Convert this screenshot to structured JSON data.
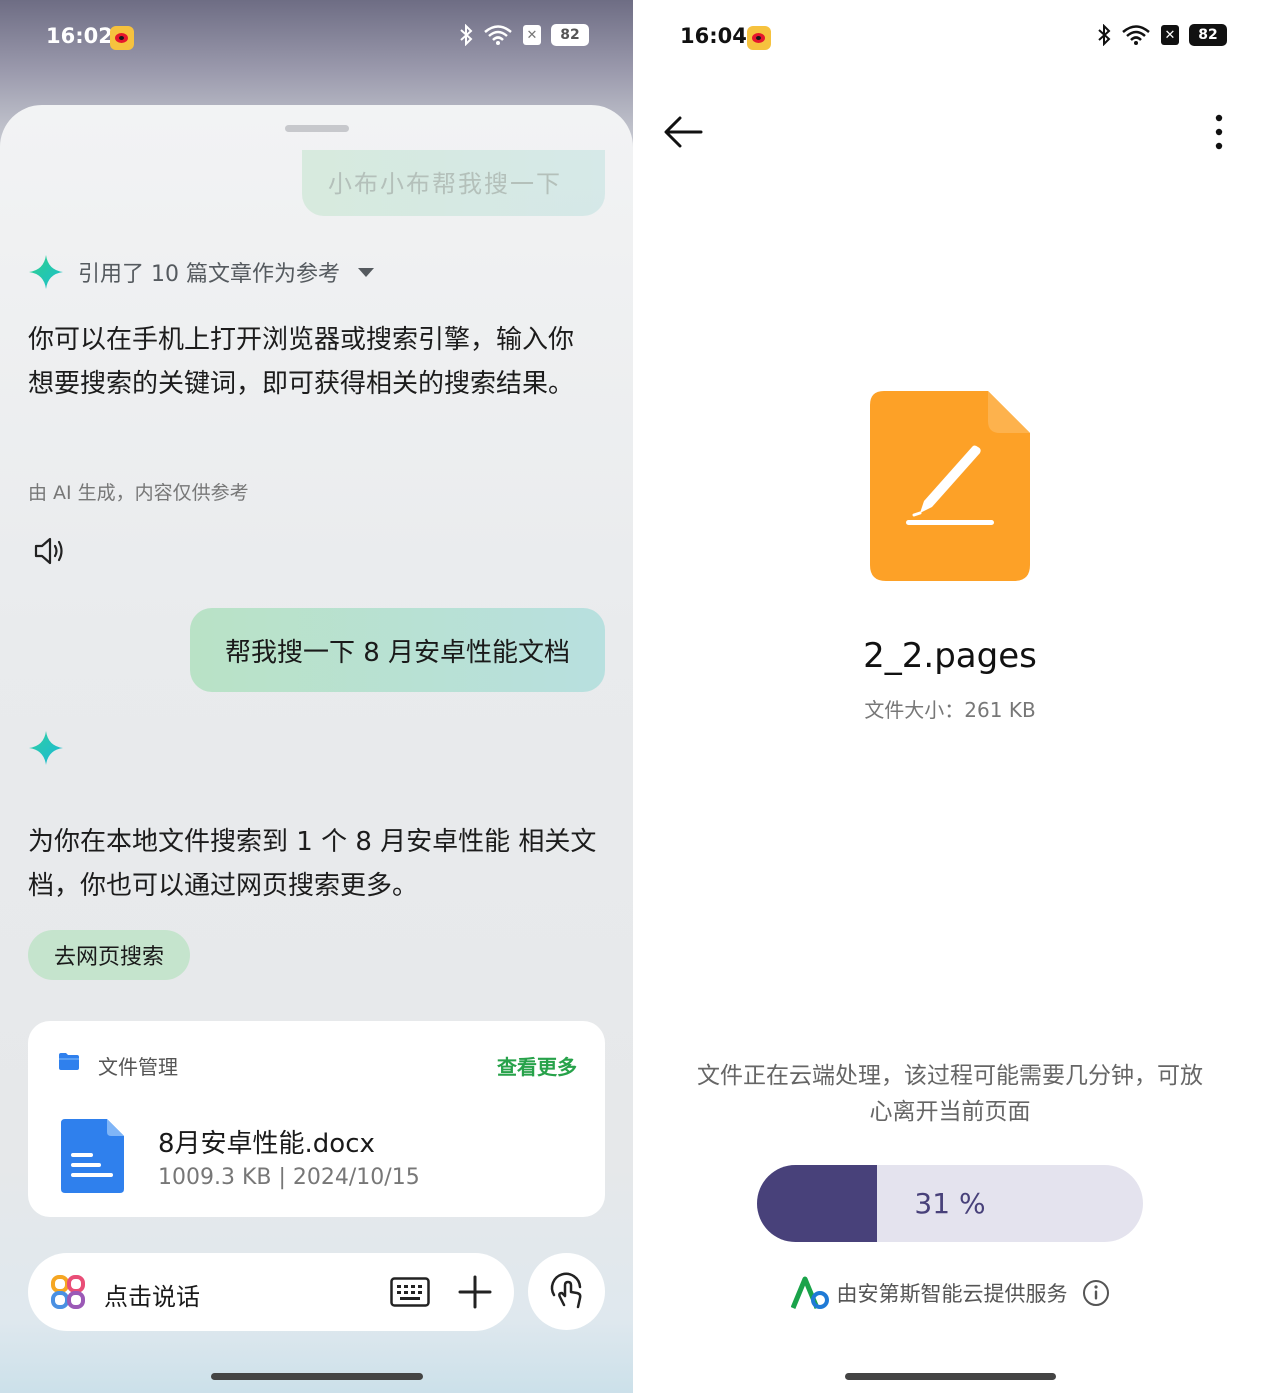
{
  "left": {
    "status": {
      "time": "16:02",
      "battery": "82"
    },
    "prev_bubble_text": "小布小布帮我搜一下",
    "ref_text": "引用了 10 篇文章作为参考",
    "answer": "你可以在手机上打开浏览器或搜索引擎，输入你想要搜索的关键词，即可获得相关的搜索结果。",
    "ai_note": "由 AI 生成，内容仅供参考",
    "user_message": "帮我搜一下 8 月安卓性能文档",
    "answer2": "为你在本地文件搜索到 1 个 8 月安卓性能 相关文档，你也可以通过网页搜索更多。",
    "web_search_button": "去网页搜索",
    "file_card": {
      "title": "文件管理",
      "more": "查看更多",
      "file_name": "8月安卓性能.docx",
      "file_meta": "1009.3 KB | 2024/10/15"
    },
    "input": {
      "placeholder": "点击说话"
    },
    "colors": {
      "accent_green": "#27a24a",
      "doc_blue": "#2f80ed"
    }
  },
  "right": {
    "status": {
      "time": "16:04",
      "battery": "82"
    },
    "file_name": "2_2.pages",
    "file_size": "文件大小：261 KB",
    "process_message": "文件正在云端处理，该过程可能需要几分钟，可放心离开当前页面",
    "progress": {
      "percent": 31,
      "label": "31 %"
    },
    "service_text": "由安第斯智能云提供服务",
    "colors": {
      "pages_orange": "#fda127",
      "progress": "#48417a"
    }
  }
}
